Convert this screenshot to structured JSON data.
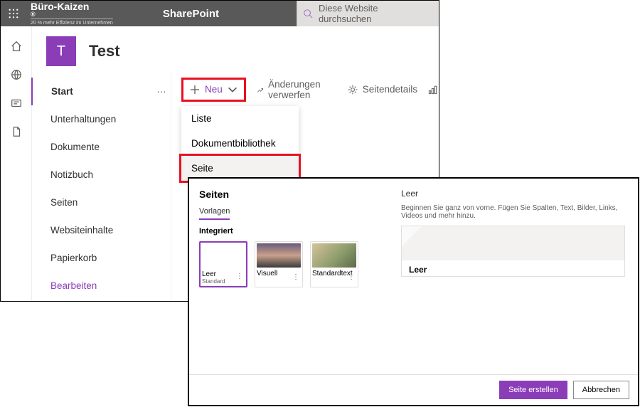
{
  "topbar": {
    "brand_name": "Büro-Kaizen",
    "brand_reg": "®",
    "brand_sub": "20 % mehr Effizienz im Unternehmen",
    "app_title": "SharePoint",
    "search_placeholder": "Diese Website durchsuchen"
  },
  "site": {
    "tile_letter": "T",
    "name": "Test"
  },
  "leftnav": {
    "items": [
      {
        "label": "Start",
        "active": true
      },
      {
        "label": "Unterhaltungen"
      },
      {
        "label": "Dokumente"
      },
      {
        "label": "Notizbuch"
      },
      {
        "label": "Seiten"
      },
      {
        "label": "Websiteinhalte"
      },
      {
        "label": "Papierkorb"
      },
      {
        "label": "Bearbeiten",
        "edit": true
      }
    ],
    "ellipsis": "…"
  },
  "cmdbar": {
    "neu_label": "Neu",
    "discard_label": "Änderungen verwerfen",
    "details_label": "Seitendetails"
  },
  "dropdown": {
    "items": [
      {
        "label": "Liste"
      },
      {
        "label": "Dokumentbibliothek"
      },
      {
        "label": "Seite",
        "highlight": true
      }
    ]
  },
  "dialog": {
    "left_header": "Seiten",
    "tab_templates": "Vorlagen",
    "section": "Integriert",
    "templates": [
      {
        "name": "Leer",
        "sub": "Standard",
        "sel": true,
        "thumb": "leer"
      },
      {
        "name": "Visuell",
        "thumb": "visuell"
      },
      {
        "name": "Standardtext",
        "thumb": "standard"
      }
    ],
    "right_header": "Leer",
    "right_desc": "Beginnen Sie ganz von vorne. Fügen Sie Spalten, Text, Bilder, Links, Videos und mehr hinzu.",
    "preview_title": "Leer",
    "btn_primary": "Seite erstellen",
    "btn_cancel": "Abbrechen"
  }
}
